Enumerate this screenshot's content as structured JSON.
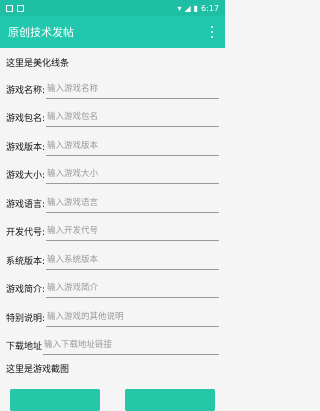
{
  "status": {
    "time": "6:17"
  },
  "appbar": {
    "title": "原创技术发帖"
  },
  "sections": {
    "line": "这里是美化线条",
    "screenshot": "这里是游戏截图"
  },
  "form": [
    {
      "label": "游戏名称:",
      "placeholder": "输入游戏名称"
    },
    {
      "label": "游戏包名:",
      "placeholder": "输入游戏包名"
    },
    {
      "label": "游戏版本:",
      "placeholder": "输入游戏版本"
    },
    {
      "label": "游戏大小:",
      "placeholder": "输入游戏大小"
    },
    {
      "label": "游戏语言:",
      "placeholder": "输入游戏语言"
    },
    {
      "label": "开发代号:",
      "placeholder": "输入开发代号"
    },
    {
      "label": "系统版本:",
      "placeholder": "输入系统版本"
    },
    {
      "label": "游戏简介:",
      "placeholder": "输入游戏简介"
    },
    {
      "label": "特别说明:",
      "placeholder": "输入游戏的其他说明"
    },
    {
      "label": "下载地址",
      "placeholder": "输入下载地址链接"
    }
  ],
  "colors": {
    "accent": "#22c8ad",
    "statusbar": "#1fbfa5"
  }
}
